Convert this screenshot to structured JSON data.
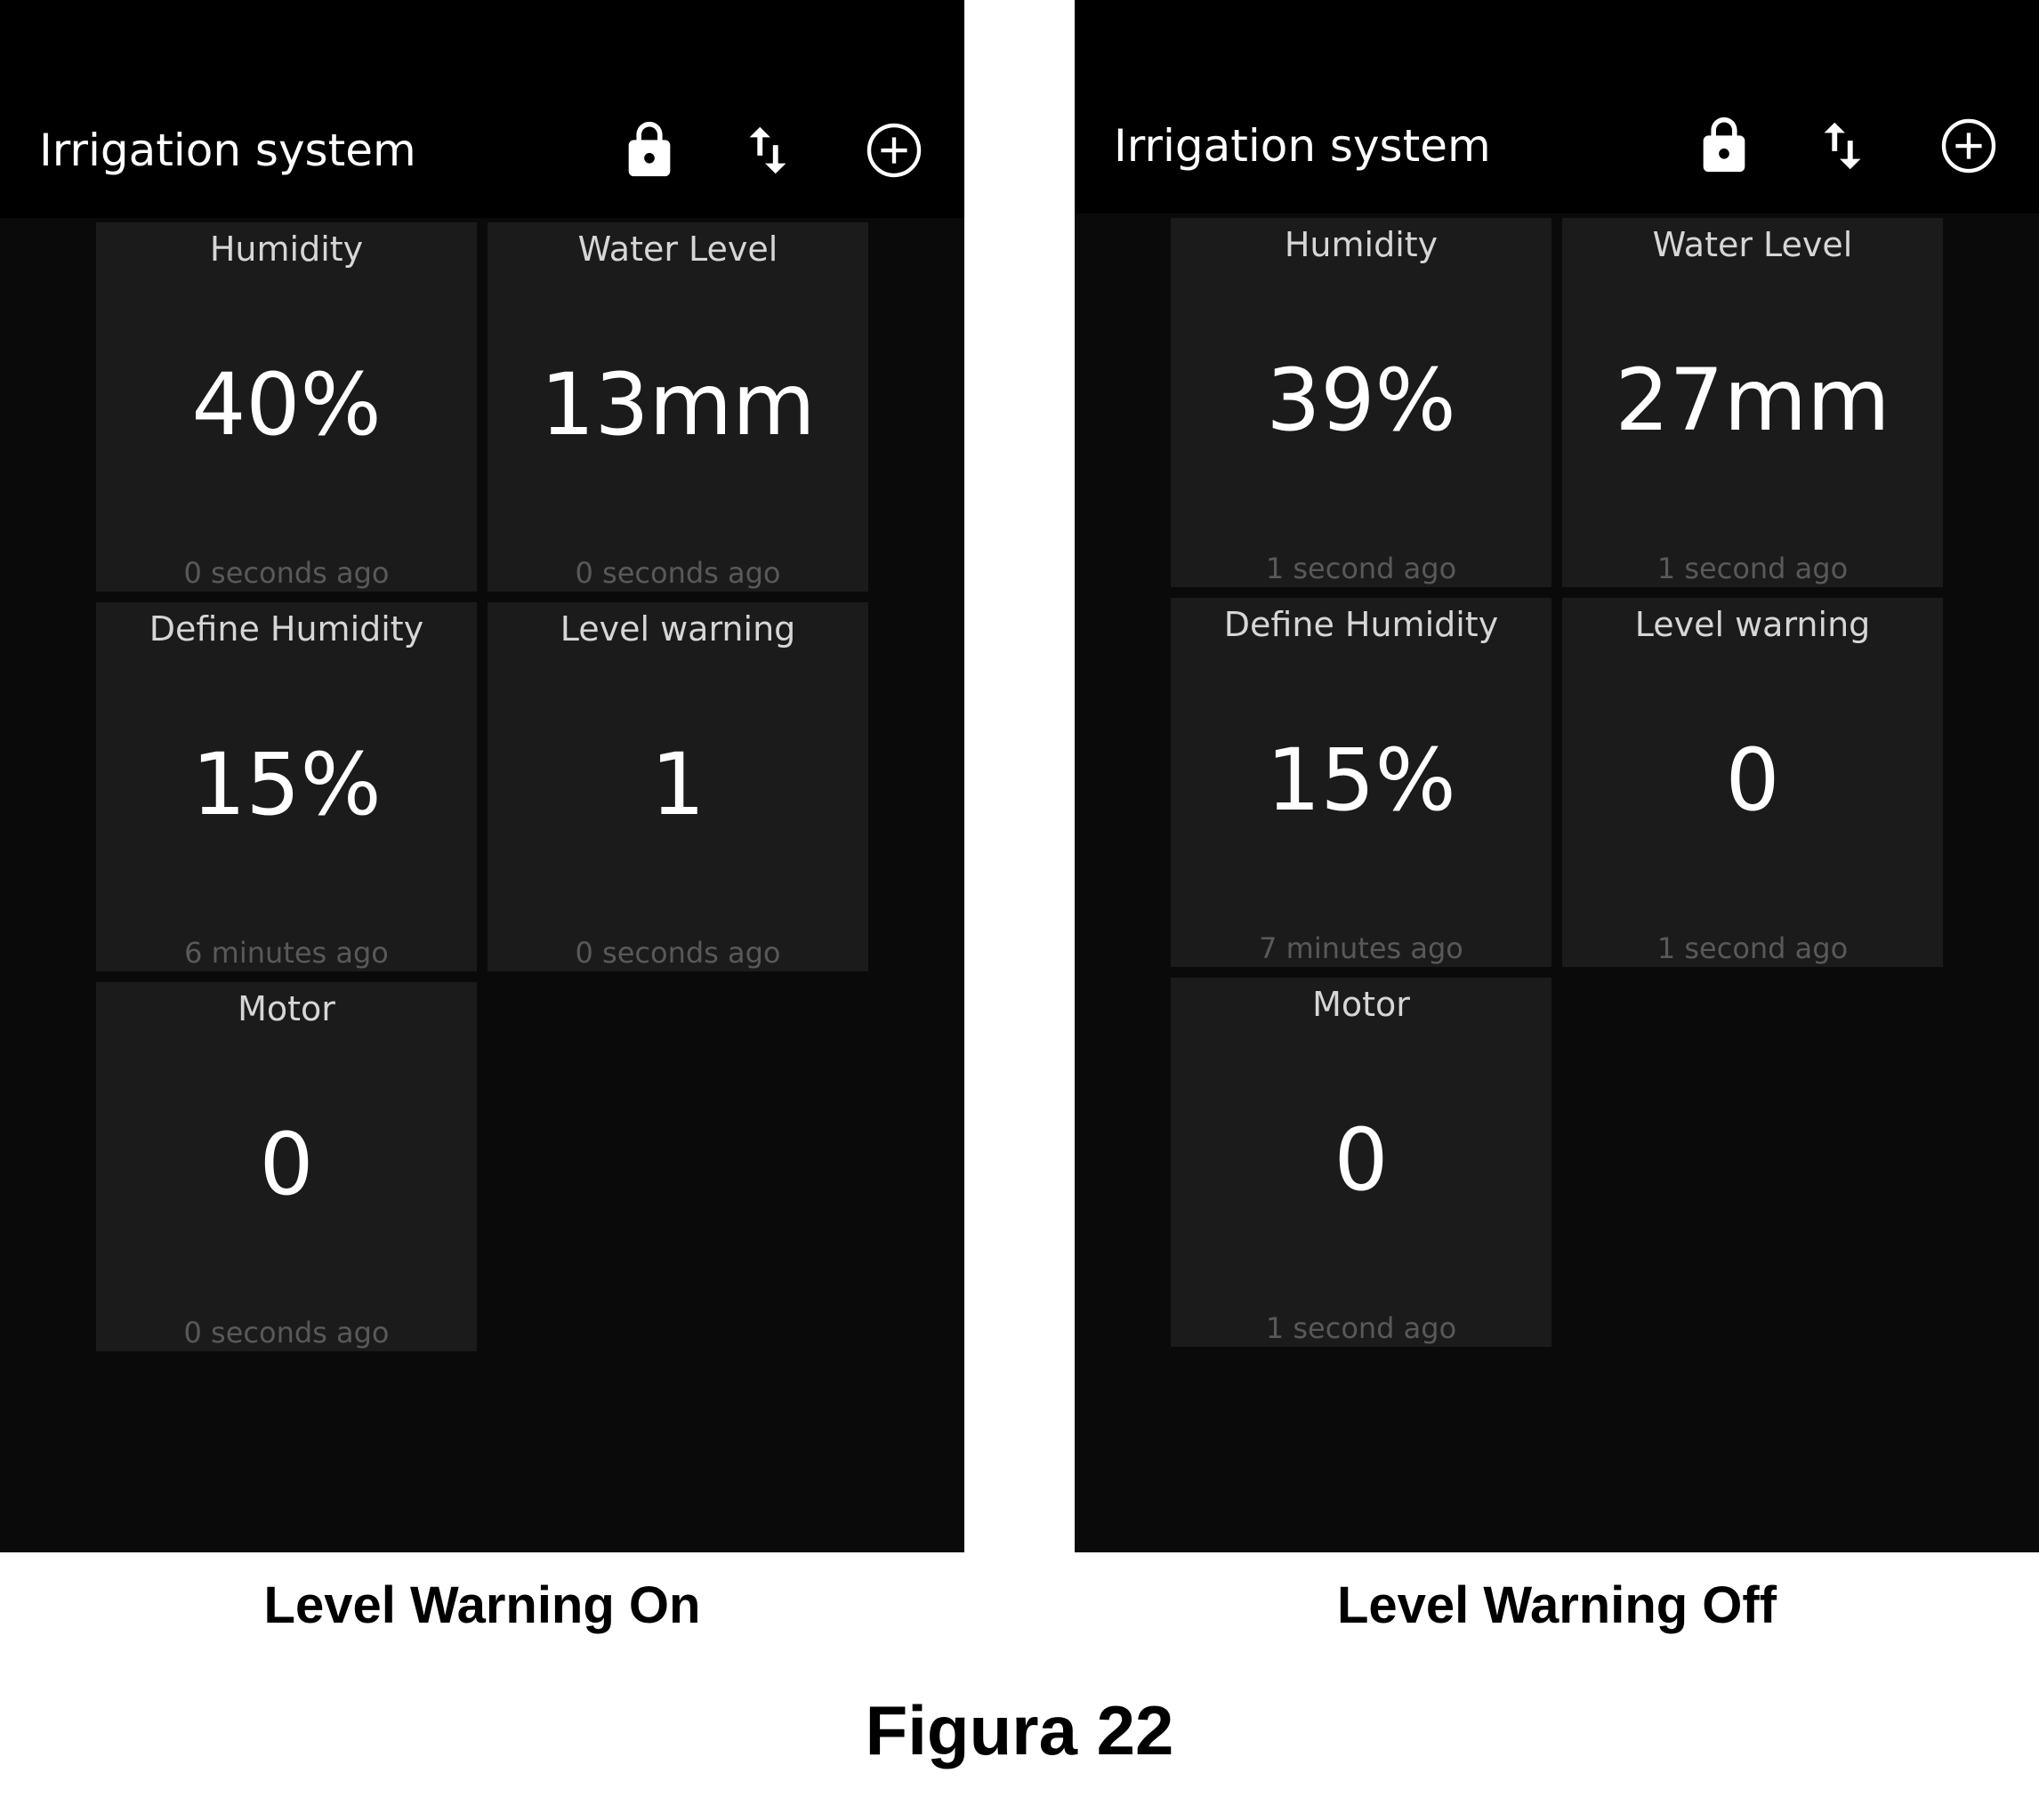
{
  "colors": {
    "screen_background": "#0a0a0a",
    "app_bar": "#000000",
    "tile_background": "#1b1b1b",
    "label_text": "#d6d6d6",
    "value_text": "#ffffff",
    "timestamp_text": "#595959"
  },
  "icons": [
    "lock-icon",
    "sort-icon",
    "add-circle-icon"
  ],
  "panels": [
    {
      "app_title": "Irrigation system",
      "caption": "Level Warning On",
      "tiles": [
        {
          "label": "Humidity",
          "value": "40%",
          "time": "0 seconds ago"
        },
        {
          "label": "Water Level",
          "value": "13mm",
          "time": "0 seconds ago"
        },
        {
          "label": "Define Humidity",
          "value": "15%",
          "time": "6 minutes ago"
        },
        {
          "label": "Level warning",
          "value": "1",
          "time": "0 seconds ago"
        },
        {
          "label": "Motor",
          "value": "0",
          "time": "0 seconds ago"
        }
      ]
    },
    {
      "app_title": "Irrigation system",
      "caption": "Level Warning Off",
      "tiles": [
        {
          "label": "Humidity",
          "value": "39%",
          "time": "1 second ago"
        },
        {
          "label": "Water Level",
          "value": "27mm",
          "time": "1 second ago"
        },
        {
          "label": "Define Humidity",
          "value": "15%",
          "time": "7 minutes ago"
        },
        {
          "label": "Level warning",
          "value": "0",
          "time": "1 second ago"
        },
        {
          "label": "Motor",
          "value": "0",
          "time": "1 second ago"
        }
      ]
    }
  ],
  "figure_title": "Figura 22"
}
